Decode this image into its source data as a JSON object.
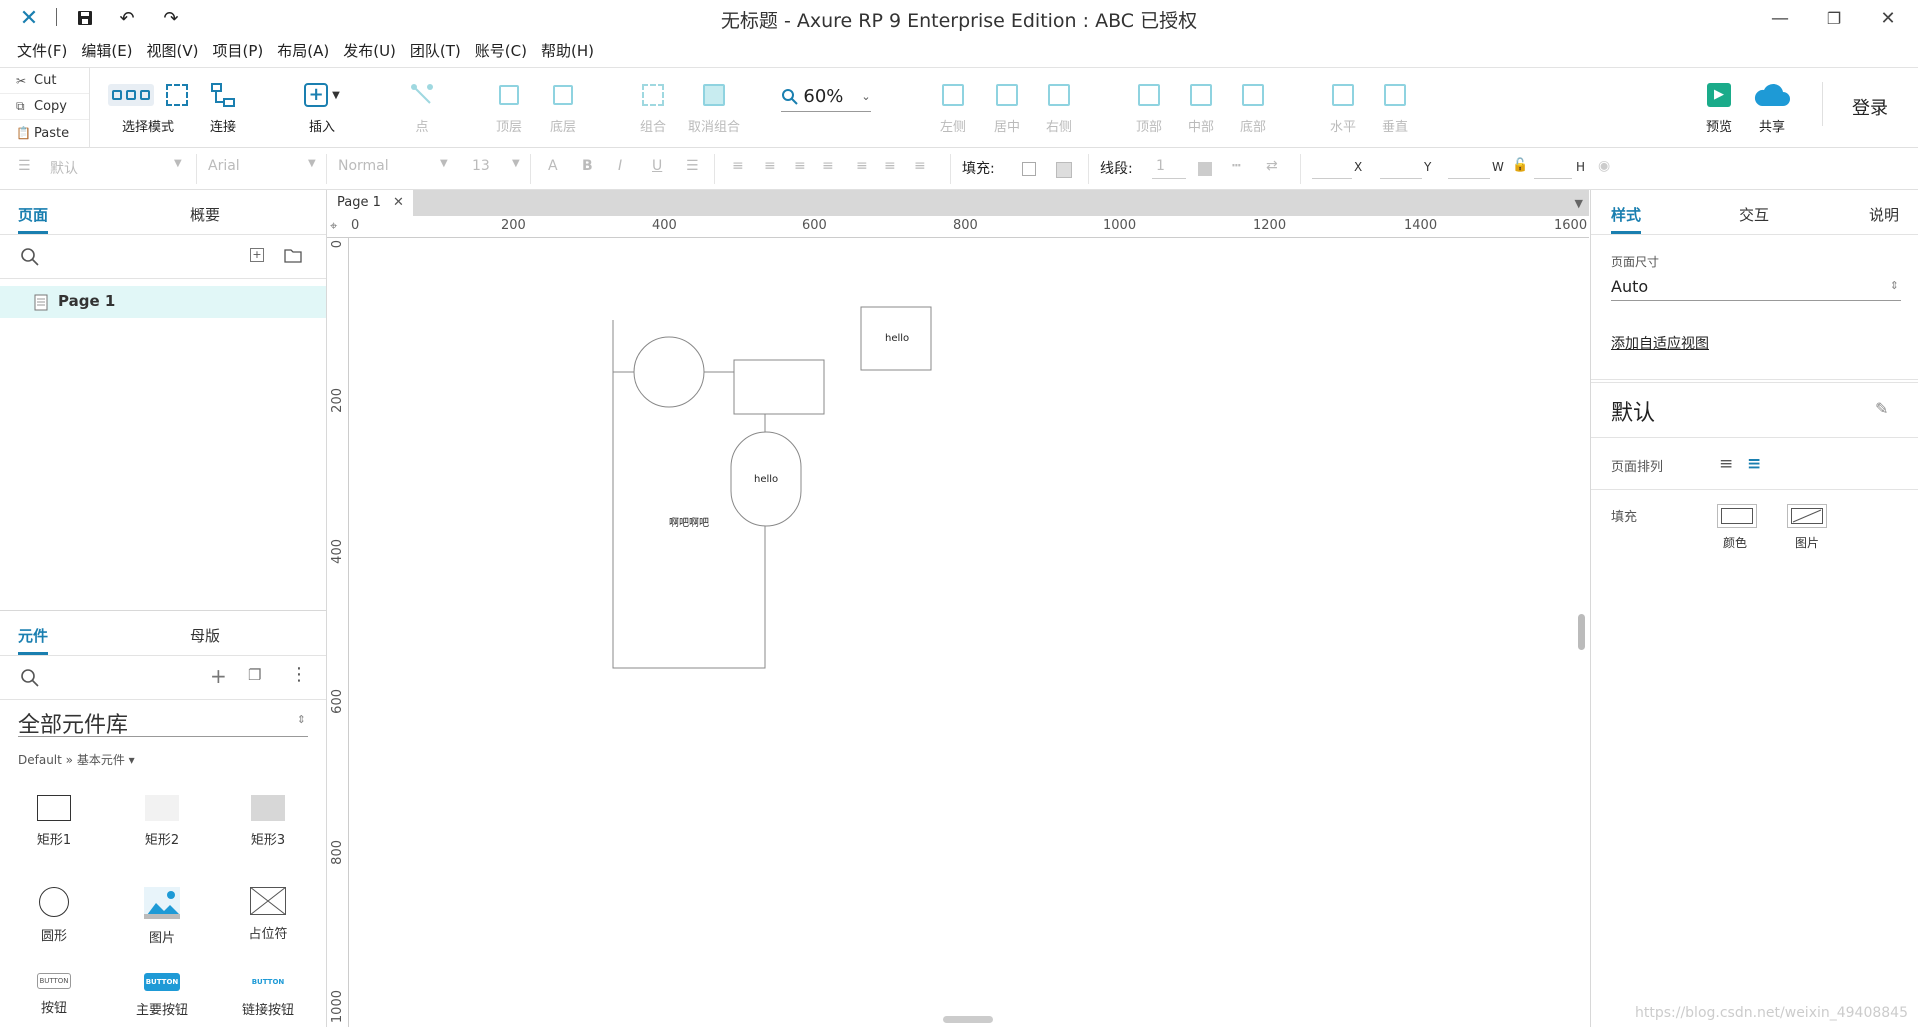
{
  "app": {
    "title": "无标题 - Axure RP 9 Enterprise Edition : ABC 已授权"
  },
  "menu": [
    "文件(F)",
    "编辑(E)",
    "视图(V)",
    "项目(P)",
    "布局(A)",
    "发布(U)",
    "团队(T)",
    "账号(C)",
    "帮助(H)"
  ],
  "clipboard": {
    "cut": "Cut",
    "copy": "Copy",
    "paste": "Paste"
  },
  "toolbar": {
    "select_mode": "选择模式",
    "connect": "连接",
    "insert": "插入",
    "point": "点",
    "zoom": "60%",
    "top_layer": "顶层",
    "bottom_layer": "底层",
    "group": "组合",
    "ungroup": "取消组合",
    "align_left": "左侧",
    "align_center": "居中",
    "align_right": "右侧",
    "align_top": "顶部",
    "align_middle": "中部",
    "align_bottom": "底部",
    "dist_h": "水平",
    "dist_v": "垂直",
    "preview": "预览",
    "share": "共享",
    "login": "登录"
  },
  "format": {
    "style": "默认",
    "font": "Arial",
    "weight": "Normal",
    "size": "13",
    "fill_label": "填充:",
    "stroke_label": "线段:",
    "stroke_value": "1",
    "x": "X",
    "y": "Y",
    "w": "W",
    "h": "H"
  },
  "pages_panel": {
    "tab_pages": "页面",
    "tab_outline": "概要",
    "page": "Page 1"
  },
  "widgets_panel": {
    "tab_widgets": "元件",
    "tab_masters": "母版",
    "library": "全部元件库",
    "breadcrumb": "Default » 基本元件 ▾",
    "items": [
      "矩形1",
      "矩形2",
      "矩形3",
      "圆形",
      "图片",
      "占位符",
      "按钮",
      "主要按钮",
      "链接按钮"
    ],
    "button_text": "BUTTON"
  },
  "canvas": {
    "tab": "Page 1",
    "hello1": "hello",
    "hello2": "hello",
    "text": "啊吧啊吧"
  },
  "ruler": {
    "h": [
      "0",
      "200",
      "400",
      "600",
      "800",
      "1000",
      "1200",
      "1400",
      "1600"
    ],
    "v": [
      "0",
      "200",
      "400",
      "600",
      "800",
      "1000"
    ]
  },
  "right_panel": {
    "tab_style": "样式",
    "tab_interact": "交互",
    "tab_notes": "说明",
    "page_size_label": "页面尺寸",
    "page_size": "Auto",
    "adaptive": "添加自适应视图",
    "default": "默认",
    "page_align": "页面排列",
    "fill": "填充",
    "fill_color": "颜色",
    "fill_image": "图片"
  },
  "watermark": "https://blog.csdn.net/weixin_49408845",
  "colors": {
    "accent": "#1a7fb0",
    "selected_row": "#e1f7f7",
    "preview": "#1aab8a",
    "share": "#1e9ad6"
  }
}
